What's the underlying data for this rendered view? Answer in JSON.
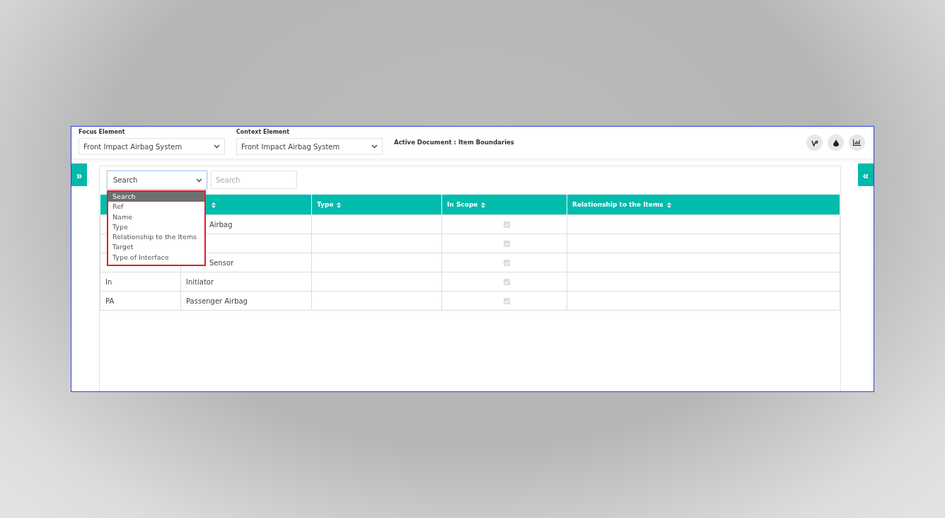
{
  "focus_element": {
    "label": "Focus Element",
    "value": "Front Impact Airbag System"
  },
  "context_element": {
    "label": "Context Element",
    "value": "Front Impact Airbag System"
  },
  "active_document": "Active Document : Item Boundaries",
  "expand_left": "»",
  "collapse_right": "«",
  "filter": {
    "select_value": "Search",
    "placeholder": "Search"
  },
  "dropdown_options": [
    {
      "label": "Search",
      "selected": true
    },
    {
      "label": "Ref",
      "selected": false
    },
    {
      "label": "Name",
      "selected": false
    },
    {
      "label": "Type",
      "selected": false
    },
    {
      "label": "Relationship to the Items",
      "selected": false
    },
    {
      "label": "Target",
      "selected": false
    },
    {
      "label": "Type of Interface",
      "selected": false
    }
  ],
  "table": {
    "columns": [
      {},
      {
        "sortable": true
      },
      {
        "label": "Type",
        "sortable": true
      },
      {
        "label": "In Scope",
        "sortable": true
      },
      {
        "label": "Relationship to the Items",
        "sortable": true
      }
    ],
    "rows": [
      {
        "name": "Airbag",
        "in_scope": true
      },
      {
        "in_scope": true
      },
      {
        "name": "Sensor",
        "in_scope": true
      },
      {
        "ref": "In",
        "name": "Initiator",
        "in_scope": true
      },
      {
        "ref": "PA",
        "name": "Passenger Airbag",
        "in_scope": true
      }
    ]
  }
}
